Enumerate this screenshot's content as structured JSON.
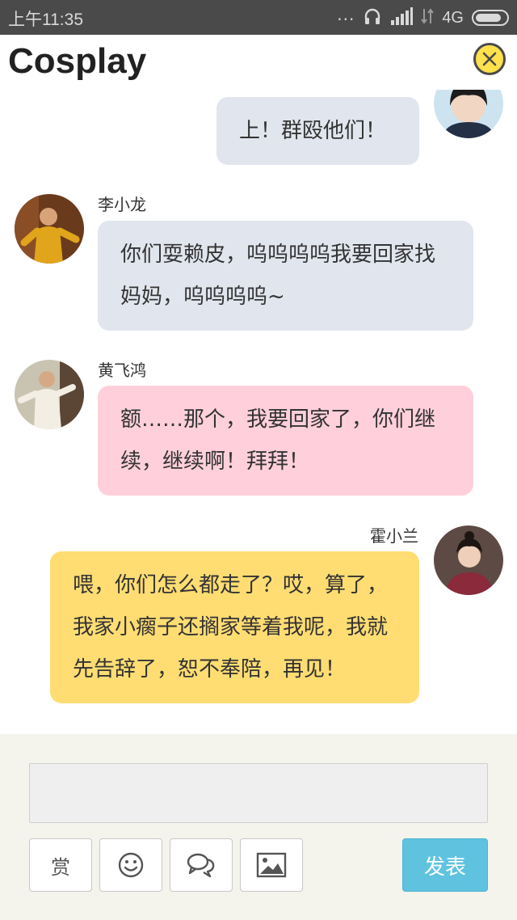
{
  "status_bar": {
    "time": "上午11:35",
    "dots": "...",
    "network": "4G",
    "battery_level": 0.85,
    "icons": [
      "headphones-icon",
      "signal-icon",
      "no-signal-icon",
      "battery-icon"
    ]
  },
  "header": {
    "title": "Cosplay",
    "close_icon": "close-icon"
  },
  "messages": [
    {
      "sender": "",
      "side": "right",
      "color": "#e1e6ee",
      "text": "上！群殴他们！"
    },
    {
      "sender": "李小龙",
      "side": "left",
      "color": "#e1e6ee",
      "text": "你们耍赖皮，呜呜呜呜我要回家找妈妈，呜呜呜呜~"
    },
    {
      "sender": "黄飞鸿",
      "side": "left",
      "color": "#ffd0dc",
      "text": "额……那个，我要回家了，你们继续，继续啊！拜拜！"
    },
    {
      "sender": "霍小兰",
      "side": "right",
      "color": "#ffdd73",
      "text": "喂，你们怎么都走了？哎，算了，我家小瘸子还搁家等着我呢，我就先告辞了，恕不奉陪，再见！"
    }
  ],
  "composer": {
    "input_value": "",
    "reward_label": "赏",
    "emoji_icon": "smiley-icon",
    "chat_icon": "chat-bubbles-icon",
    "image_icon": "image-icon",
    "send_label": "发表"
  },
  "colors": {
    "accent": "#5fc3e0",
    "close_button": "#ffe04d",
    "composer_bg": "#f4f3ec"
  }
}
